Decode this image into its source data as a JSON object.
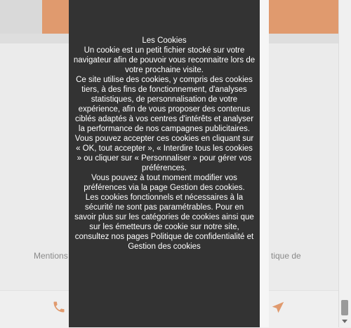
{
  "background": {
    "footer_left": "Mentions",
    "footer_right": "tique de"
  },
  "cookie_modal": {
    "title": "Les Cookies",
    "paragraphs": [
      "Un cookie est un petit fichier stocké sur votre navigateur afin de pouvoir vous reconnaitre lors de votre prochaine visite.",
      "Ce site utilise des cookies, y compris des cookies tiers, à des fins de fonctionnement, d'analyses statistiques, de personnalisation de votre expérience, afin de vous proposer des contenus ciblés adaptés à vos centres d'intérêts et analyser la performance de nos campagnes publicitaires.",
      "Vous pouvez accepter ces cookies en cliquant sur « OK, tout accepter », « Interdire tous les cookies  » ou cliquer sur « Personnaliser » pour gérer vos préférences.",
      "Vous pouvez à tout moment modifier vos préférences via la page Gestion des cookies.",
      "Les cookies fonctionnels et nécessaires à la sécurité ne sont pas paramétrables. Pour en savoir plus sur les catégories de cookies ainsi que sur les émetteurs de cookie sur notre site, consultez nos pages Politique de confidentialité et Gestion des cookies"
    ]
  },
  "icons": {
    "phone": "phone-icon",
    "navigation": "navigation-arrow-icon"
  },
  "colors": {
    "modal_bg": "#333333",
    "accent_orange": "#e09a6e"
  }
}
